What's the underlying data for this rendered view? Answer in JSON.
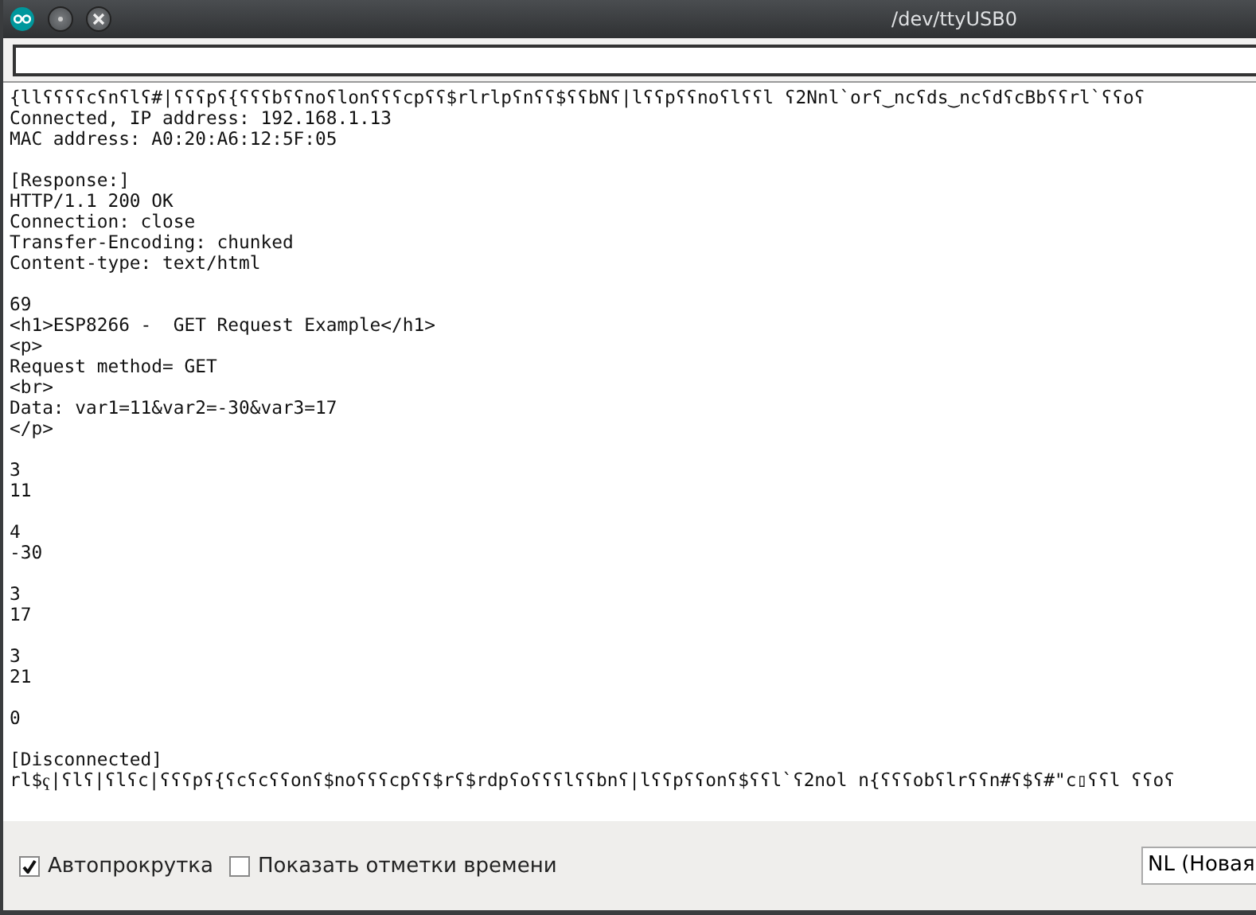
{
  "window": {
    "title": "/dev/ttyUSB0"
  },
  "output": [
    {
      "lines": [
        "{llʕʕʕʕcʕnʕlʕ#|ʕʕʕpʕ{ʕʕʕbʕʕnoʕlonʕʕʕcpʕʕ$rlrlpʕnʕʕ$ʕʕbNʕ|lʕʕpʕʕnoʕlʕʕl ʕ2Nnl`orʕ‿ncʕds‿ncʕdʕcBbʕʕrl`ʕʕoʕ",
        "Connected, IP address: 192.168.1.13",
        "MAC address: A0:20:A6:12:5F:05"
      ]
    },
    {
      "lines": [
        "[Response:]",
        "HTTP/1.1 200 OK",
        "Connection: close",
        "Transfer-Encoding: chunked",
        "Content-type: text/html"
      ]
    },
    {
      "lines": [
        "69",
        "<h1>ESP8266 -  GET Request Example</h1>",
        "<p>",
        "Request method= GET",
        "<br>",
        "Data: var1=11&var2=-30&var3=17",
        "</p>"
      ]
    },
    {
      "lines": [
        "3",
        "11"
      ]
    },
    {
      "lines": [
        "4",
        "-30"
      ]
    },
    {
      "lines": [
        "3",
        "17"
      ]
    },
    {
      "lines": [
        "3",
        "21"
      ]
    },
    {
      "lines": [
        "0"
      ]
    },
    {
      "lines": [
        "[Disconnected]",
        "rl$ҁ|ʕlʕ|ʕlʕc|ʕʕʕpʕ{ʕcʕcʕʕonʕ$noʕʕʕcpʕʕ$rʕ$rdpʕoʕʕʕlʕʕbnʕ|lʕʕpʕʕonʕ$ʕʕl`ʕ2nol n{ʕʕʕobʕlrʕʕn#ʕ$ʕ#\"c▯ʕʕl ʕʕoʕ"
      ]
    }
  ],
  "options": [
    {
      "label": "Автопрокрутка",
      "checked": true
    },
    {
      "label": "Показать отметки времени",
      "checked": false
    }
  ],
  "line_ending": {
    "value": "NL (Новая"
  }
}
